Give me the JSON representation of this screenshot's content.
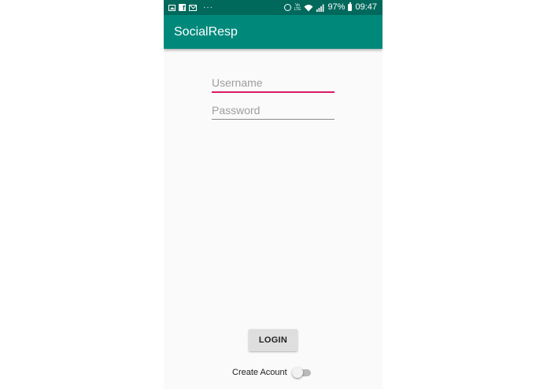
{
  "status_bar": {
    "left_icons": [
      "gallery-icon",
      "facebook-icon",
      "mail-icon",
      "more-dots-icon"
    ],
    "more_dots": "···",
    "volte": "VoLTE",
    "battery_percent": "97%",
    "time": "09:47",
    "right_icons": [
      "alarm-icon",
      "volte-icon",
      "wifi-icon",
      "signal-icon",
      "battery-icon"
    ]
  },
  "app_bar": {
    "title": "SocialResp"
  },
  "form": {
    "username": {
      "value": "",
      "placeholder": "Username"
    },
    "password": {
      "value": "",
      "placeholder": "Password"
    },
    "login_label": "LOGIN",
    "create_account": {
      "label": "Create Acount",
      "checked": false
    }
  },
  "colors": {
    "status_bar": "#00695c",
    "app_bar": "#00897b",
    "accent_focus": "#d81b60",
    "background": "#fafafa"
  }
}
